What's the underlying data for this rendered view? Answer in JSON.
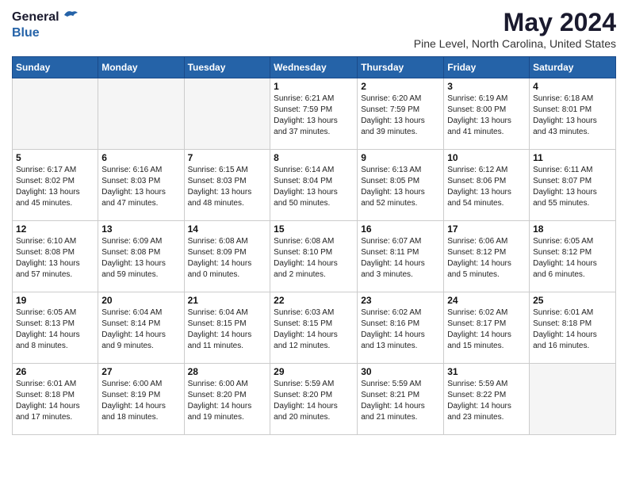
{
  "logo": {
    "general": "General",
    "blue": "Blue"
  },
  "title": "May 2024",
  "subtitle": "Pine Level, North Carolina, United States",
  "days_of_week": [
    "Sunday",
    "Monday",
    "Tuesday",
    "Wednesday",
    "Thursday",
    "Friday",
    "Saturday"
  ],
  "weeks": [
    [
      {
        "day": "",
        "info": ""
      },
      {
        "day": "",
        "info": ""
      },
      {
        "day": "",
        "info": ""
      },
      {
        "day": "1",
        "info": "Sunrise: 6:21 AM\nSunset: 7:59 PM\nDaylight: 13 hours\nand 37 minutes."
      },
      {
        "day": "2",
        "info": "Sunrise: 6:20 AM\nSunset: 7:59 PM\nDaylight: 13 hours\nand 39 minutes."
      },
      {
        "day": "3",
        "info": "Sunrise: 6:19 AM\nSunset: 8:00 PM\nDaylight: 13 hours\nand 41 minutes."
      },
      {
        "day": "4",
        "info": "Sunrise: 6:18 AM\nSunset: 8:01 PM\nDaylight: 13 hours\nand 43 minutes."
      }
    ],
    [
      {
        "day": "5",
        "info": "Sunrise: 6:17 AM\nSunset: 8:02 PM\nDaylight: 13 hours\nand 45 minutes."
      },
      {
        "day": "6",
        "info": "Sunrise: 6:16 AM\nSunset: 8:03 PM\nDaylight: 13 hours\nand 47 minutes."
      },
      {
        "day": "7",
        "info": "Sunrise: 6:15 AM\nSunset: 8:03 PM\nDaylight: 13 hours\nand 48 minutes."
      },
      {
        "day": "8",
        "info": "Sunrise: 6:14 AM\nSunset: 8:04 PM\nDaylight: 13 hours\nand 50 minutes."
      },
      {
        "day": "9",
        "info": "Sunrise: 6:13 AM\nSunset: 8:05 PM\nDaylight: 13 hours\nand 52 minutes."
      },
      {
        "day": "10",
        "info": "Sunrise: 6:12 AM\nSunset: 8:06 PM\nDaylight: 13 hours\nand 54 minutes."
      },
      {
        "day": "11",
        "info": "Sunrise: 6:11 AM\nSunset: 8:07 PM\nDaylight: 13 hours\nand 55 minutes."
      }
    ],
    [
      {
        "day": "12",
        "info": "Sunrise: 6:10 AM\nSunset: 8:08 PM\nDaylight: 13 hours\nand 57 minutes."
      },
      {
        "day": "13",
        "info": "Sunrise: 6:09 AM\nSunset: 8:08 PM\nDaylight: 13 hours\nand 59 minutes."
      },
      {
        "day": "14",
        "info": "Sunrise: 6:08 AM\nSunset: 8:09 PM\nDaylight: 14 hours\nand 0 minutes."
      },
      {
        "day": "15",
        "info": "Sunrise: 6:08 AM\nSunset: 8:10 PM\nDaylight: 14 hours\nand 2 minutes."
      },
      {
        "day": "16",
        "info": "Sunrise: 6:07 AM\nSunset: 8:11 PM\nDaylight: 14 hours\nand 3 minutes."
      },
      {
        "day": "17",
        "info": "Sunrise: 6:06 AM\nSunset: 8:12 PM\nDaylight: 14 hours\nand 5 minutes."
      },
      {
        "day": "18",
        "info": "Sunrise: 6:05 AM\nSunset: 8:12 PM\nDaylight: 14 hours\nand 6 minutes."
      }
    ],
    [
      {
        "day": "19",
        "info": "Sunrise: 6:05 AM\nSunset: 8:13 PM\nDaylight: 14 hours\nand 8 minutes."
      },
      {
        "day": "20",
        "info": "Sunrise: 6:04 AM\nSunset: 8:14 PM\nDaylight: 14 hours\nand 9 minutes."
      },
      {
        "day": "21",
        "info": "Sunrise: 6:04 AM\nSunset: 8:15 PM\nDaylight: 14 hours\nand 11 minutes."
      },
      {
        "day": "22",
        "info": "Sunrise: 6:03 AM\nSunset: 8:15 PM\nDaylight: 14 hours\nand 12 minutes."
      },
      {
        "day": "23",
        "info": "Sunrise: 6:02 AM\nSunset: 8:16 PM\nDaylight: 14 hours\nand 13 minutes."
      },
      {
        "day": "24",
        "info": "Sunrise: 6:02 AM\nSunset: 8:17 PM\nDaylight: 14 hours\nand 15 minutes."
      },
      {
        "day": "25",
        "info": "Sunrise: 6:01 AM\nSunset: 8:18 PM\nDaylight: 14 hours\nand 16 minutes."
      }
    ],
    [
      {
        "day": "26",
        "info": "Sunrise: 6:01 AM\nSunset: 8:18 PM\nDaylight: 14 hours\nand 17 minutes."
      },
      {
        "day": "27",
        "info": "Sunrise: 6:00 AM\nSunset: 8:19 PM\nDaylight: 14 hours\nand 18 minutes."
      },
      {
        "day": "28",
        "info": "Sunrise: 6:00 AM\nSunset: 8:20 PM\nDaylight: 14 hours\nand 19 minutes."
      },
      {
        "day": "29",
        "info": "Sunrise: 5:59 AM\nSunset: 8:20 PM\nDaylight: 14 hours\nand 20 minutes."
      },
      {
        "day": "30",
        "info": "Sunrise: 5:59 AM\nSunset: 8:21 PM\nDaylight: 14 hours\nand 21 minutes."
      },
      {
        "day": "31",
        "info": "Sunrise: 5:59 AM\nSunset: 8:22 PM\nDaylight: 14 hours\nand 23 minutes."
      },
      {
        "day": "",
        "info": ""
      }
    ]
  ]
}
